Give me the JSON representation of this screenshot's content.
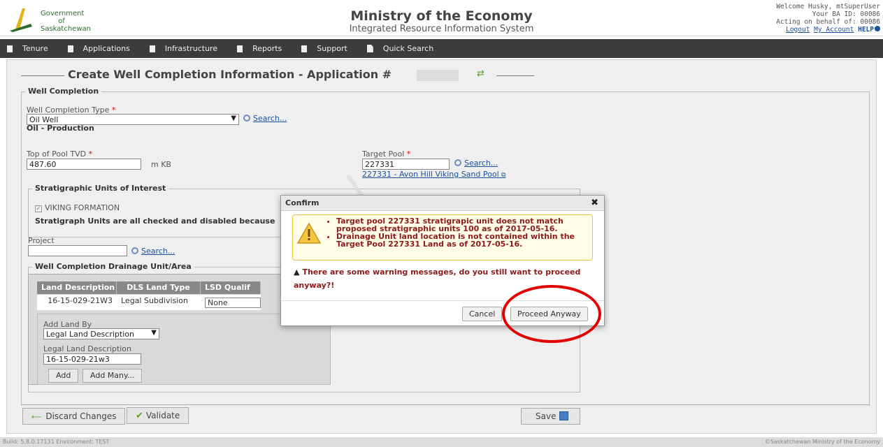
{
  "header": {
    "gov_line1": "Government",
    "gov_line2": "of",
    "gov_line3": "Saskatchewan",
    "title": "Ministry of the Economy",
    "subtitle": "Integrated Resource Information System",
    "user": {
      "welcome": "Welcome Husky, mtSuperUser",
      "ba_id": "Your BA ID: 00086",
      "acting": "Acting on behalf of: 00086",
      "logout": "Logout",
      "my_account": "My Account",
      "help": "HELP"
    }
  },
  "nav": {
    "items": [
      {
        "label": "Tenure",
        "icon": "bookmark-icon"
      },
      {
        "label": "Applications",
        "icon": "bookmark-icon"
      },
      {
        "label": "Infrastructure",
        "icon": "bookmark-icon"
      },
      {
        "label": "Reports",
        "icon": "bookmark-icon"
      },
      {
        "label": "Support",
        "icon": "bookmark-icon"
      },
      {
        "label": "Quick Search",
        "icon": "document-icon"
      }
    ]
  },
  "page": {
    "title": "Create Well Completion Information - Application #",
    "section_well_completion": "Well Completion",
    "well_completion_type_label": "Well Completion Type",
    "well_completion_type_value": "Oil Well",
    "well_completion_type_desc": "Oil - Production",
    "search_label": "Search...",
    "top_of_pool_label": "Top of Pool TVD",
    "top_of_pool_value": "487.60",
    "top_of_pool_unit": "m KB",
    "target_pool_label": "Target Pool",
    "target_pool_value": "227331",
    "target_pool_link": "227331 - Avon Hill Viking Sand Pool",
    "strat_section": "Stratigraphic Units of Interest",
    "strat_checkbox_label": "VIKING FORMATION",
    "strat_note": "Stratigraph Units are all checked and disabled because",
    "project_label": "Project",
    "project_value": "",
    "drainage_section": "Well Completion Drainage Unit/Area",
    "table": {
      "headers": [
        "Land Description",
        "DLS Land Type",
        "LSD Qualif"
      ],
      "rows": [
        {
          "land_description": "16-15-029-21W3",
          "dls_land_type": "Legal Subdivision",
          "lsd_qualifier": "None"
        }
      ]
    },
    "add_land_by_label": "Add Land By",
    "add_land_by_value": "Legal Land Description",
    "legal_land_label": "Legal Land Description",
    "legal_land_value": "16-15-029-21w3",
    "add_button": "Add",
    "add_many_button": "Add Many...",
    "discard_button": "Discard Changes",
    "validate_button": "Validate",
    "save_button": "Save"
  },
  "modal": {
    "title": "Confirm",
    "close": "✖",
    "warnings": [
      "Target pool 227331 stratigrapic unit does not match proposed stratigraphic units 100 as of 2017-05-16.",
      "Drainage Unit land location is not contained within the Target Pool 227331 Land as of 2017-05-16."
    ],
    "message": "There are some warning messages, do you still want to proceed anyway?!",
    "cancel_button": "Cancel",
    "proceed_button": "Proceed Anyway"
  },
  "footer": {
    "left": "Build: 5.8.0.17131 Environment: TEST",
    "right": "©Saskatchewan Ministry of the Economy"
  },
  "colors": {
    "nav_bg": "#3c3c3c",
    "warning_text": "#8b1a1a",
    "annotation": "#e30000",
    "link": "#1a4f9c"
  }
}
